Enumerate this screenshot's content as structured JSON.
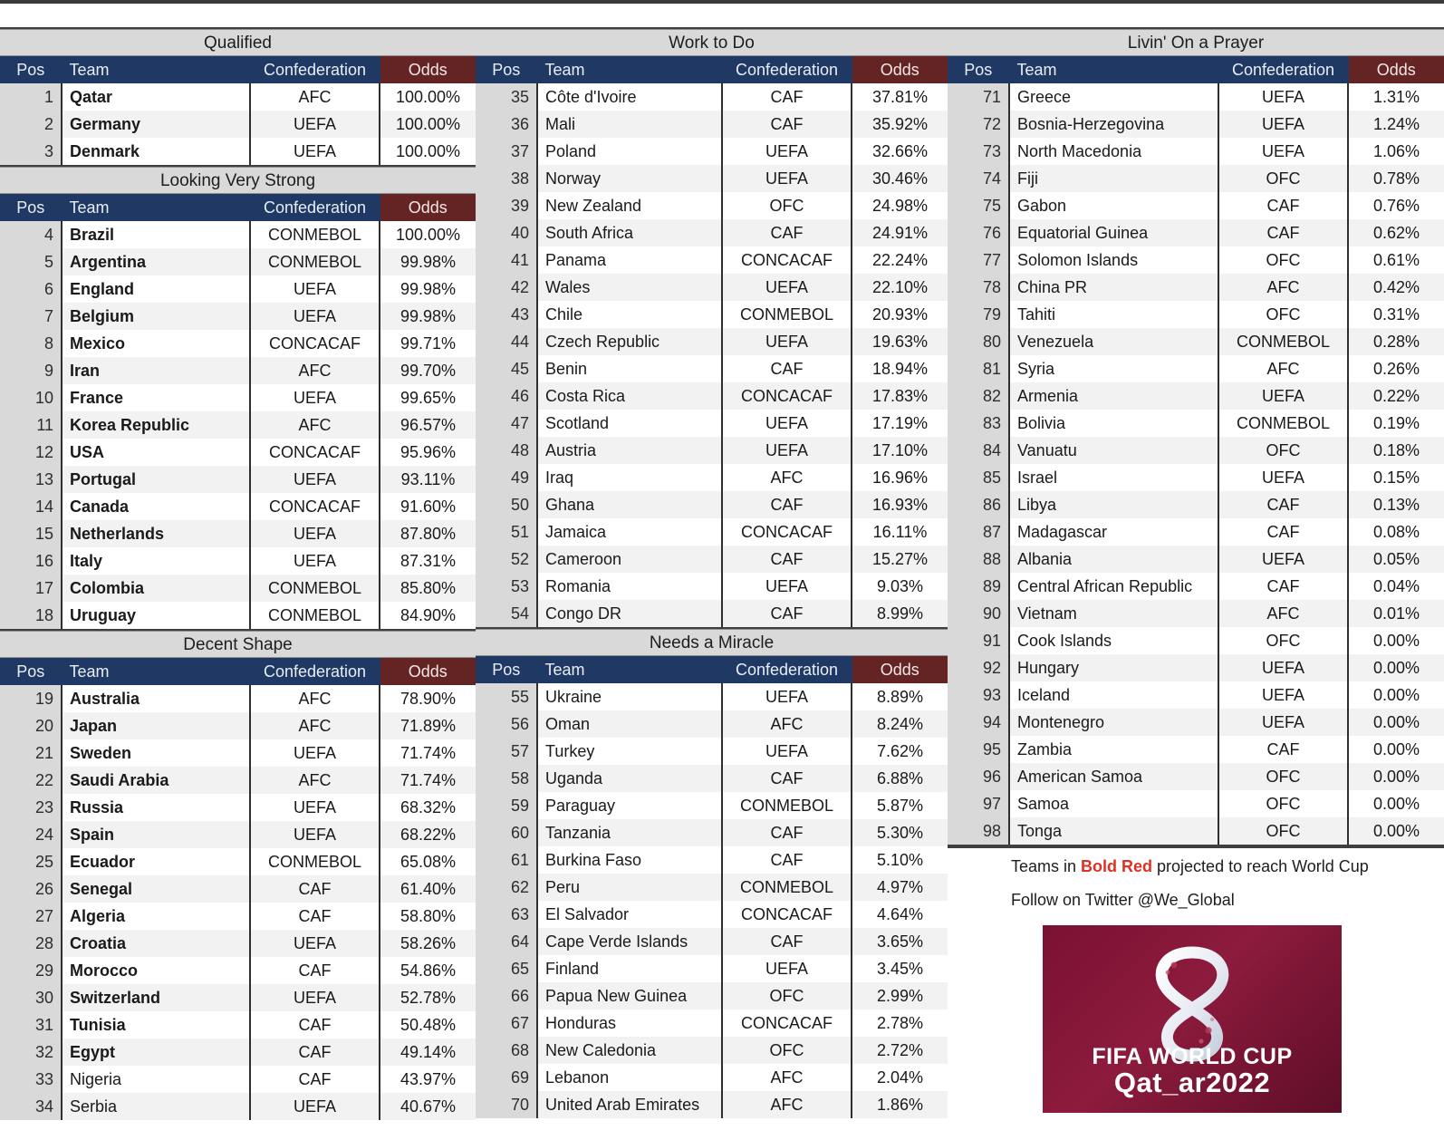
{
  "columns_headers": {
    "pos": "Pos",
    "team": "Team",
    "confederation": "Confederation",
    "odds": "Odds"
  },
  "colors": {
    "header_navy": "#203864",
    "header_maroon": "#632423",
    "band_gray": "#d9d9d9",
    "qualified_red": "#e03024"
  },
  "sections": [
    {
      "id": "qualified",
      "title": "Qualified",
      "rows": [
        {
          "pos": "1",
          "team": "Qatar",
          "conf": "AFC",
          "odds": "100.00%",
          "q": true
        },
        {
          "pos": "2",
          "team": "Germany",
          "conf": "UEFA",
          "odds": "100.00%",
          "q": true
        },
        {
          "pos": "3",
          "team": "Denmark",
          "conf": "UEFA",
          "odds": "100.00%",
          "q": true
        }
      ]
    },
    {
      "id": "looking-very-strong",
      "title": "Looking Very Strong",
      "rows": [
        {
          "pos": "4",
          "team": "Brazil",
          "conf": "CONMEBOL",
          "odds": "100.00%",
          "q": true
        },
        {
          "pos": "5",
          "team": "Argentina",
          "conf": "CONMEBOL",
          "odds": "99.98%",
          "q": true
        },
        {
          "pos": "6",
          "team": "England",
          "conf": "UEFA",
          "odds": "99.98%",
          "q": true
        },
        {
          "pos": "7",
          "team": "Belgium",
          "conf": "UEFA",
          "odds": "99.98%",
          "q": true
        },
        {
          "pos": "8",
          "team": "Mexico",
          "conf": "CONCACAF",
          "odds": "99.71%",
          "q": true
        },
        {
          "pos": "9",
          "team": "Iran",
          "conf": "AFC",
          "odds": "99.70%",
          "q": true
        },
        {
          "pos": "10",
          "team": "France",
          "conf": "UEFA",
          "odds": "99.65%",
          "q": true
        },
        {
          "pos": "11",
          "team": "Korea Republic",
          "conf": "AFC",
          "odds": "96.57%",
          "q": true
        },
        {
          "pos": "12",
          "team": "USA",
          "conf": "CONCACAF",
          "odds": "95.96%",
          "q": true
        },
        {
          "pos": "13",
          "team": "Portugal",
          "conf": "UEFA",
          "odds": "93.11%",
          "q": true
        },
        {
          "pos": "14",
          "team": "Canada",
          "conf": "CONCACAF",
          "odds": "91.60%",
          "q": true
        },
        {
          "pos": "15",
          "team": "Netherlands",
          "conf": "UEFA",
          "odds": "87.80%",
          "q": true
        },
        {
          "pos": "16",
          "team": "Italy",
          "conf": "UEFA",
          "odds": "87.31%",
          "q": true
        },
        {
          "pos": "17",
          "team": "Colombia",
          "conf": "CONMEBOL",
          "odds": "85.80%",
          "q": true
        },
        {
          "pos": "18",
          "team": "Uruguay",
          "conf": "CONMEBOL",
          "odds": "84.90%",
          "q": true
        }
      ]
    },
    {
      "id": "decent-shape",
      "title": "Decent Shape",
      "rows": [
        {
          "pos": "19",
          "team": "Australia",
          "conf": "AFC",
          "odds": "78.90%",
          "q": true
        },
        {
          "pos": "20",
          "team": "Japan",
          "conf": "AFC",
          "odds": "71.89%",
          "q": true
        },
        {
          "pos": "21",
          "team": "Sweden",
          "conf": "UEFA",
          "odds": "71.74%",
          "q": true
        },
        {
          "pos": "22",
          "team": "Saudi Arabia",
          "conf": "AFC",
          "odds": "71.74%",
          "q": true
        },
        {
          "pos": "23",
          "team": "Russia",
          "conf": "UEFA",
          "odds": "68.32%",
          "q": true
        },
        {
          "pos": "24",
          "team": "Spain",
          "conf": "UEFA",
          "odds": "68.22%",
          "q": true
        },
        {
          "pos": "25",
          "team": "Ecuador",
          "conf": "CONMEBOL",
          "odds": "65.08%",
          "q": true
        },
        {
          "pos": "26",
          "team": "Senegal",
          "conf": "CAF",
          "odds": "61.40%",
          "q": true
        },
        {
          "pos": "27",
          "team": "Algeria",
          "conf": "CAF",
          "odds": "58.80%",
          "q": true
        },
        {
          "pos": "28",
          "team": "Croatia",
          "conf": "UEFA",
          "odds": "58.26%",
          "q": true
        },
        {
          "pos": "29",
          "team": "Morocco",
          "conf": "CAF",
          "odds": "54.86%",
          "q": true
        },
        {
          "pos": "30",
          "team": "Switzerland",
          "conf": "UEFA",
          "odds": "52.78%",
          "q": true
        },
        {
          "pos": "31",
          "team": "Tunisia",
          "conf": "CAF",
          "odds": "50.48%",
          "q": true
        },
        {
          "pos": "32",
          "team": "Egypt",
          "conf": "CAF",
          "odds": "49.14%",
          "q": true
        },
        {
          "pos": "33",
          "team": "Nigeria",
          "conf": "CAF",
          "odds": "43.97%",
          "q": false
        },
        {
          "pos": "34",
          "team": "Serbia",
          "conf": "UEFA",
          "odds": "40.67%",
          "q": false
        }
      ]
    },
    {
      "id": "work-to-do",
      "title": "Work to Do",
      "rows": [
        {
          "pos": "35",
          "team": "Côte d'Ivoire",
          "conf": "CAF",
          "odds": "37.81%",
          "q": false
        },
        {
          "pos": "36",
          "team": "Mali",
          "conf": "CAF",
          "odds": "35.92%",
          "q": false
        },
        {
          "pos": "37",
          "team": "Poland",
          "conf": "UEFA",
          "odds": "32.66%",
          "q": false
        },
        {
          "pos": "38",
          "team": "Norway",
          "conf": "UEFA",
          "odds": "30.46%",
          "q": false
        },
        {
          "pos": "39",
          "team": "New Zealand",
          "conf": "OFC",
          "odds": "24.98%",
          "q": false
        },
        {
          "pos": "40",
          "team": "South Africa",
          "conf": "CAF",
          "odds": "24.91%",
          "q": false
        },
        {
          "pos": "41",
          "team": "Panama",
          "conf": "CONCACAF",
          "odds": "22.24%",
          "q": false
        },
        {
          "pos": "42",
          "team": "Wales",
          "conf": "UEFA",
          "odds": "22.10%",
          "q": false
        },
        {
          "pos": "43",
          "team": "Chile",
          "conf": "CONMEBOL",
          "odds": "20.93%",
          "q": false
        },
        {
          "pos": "44",
          "team": "Czech Republic",
          "conf": "UEFA",
          "odds": "19.63%",
          "q": false
        },
        {
          "pos": "45",
          "team": "Benin",
          "conf": "CAF",
          "odds": "18.94%",
          "q": false
        },
        {
          "pos": "46",
          "team": "Costa Rica",
          "conf": "CONCACAF",
          "odds": "17.83%",
          "q": false
        },
        {
          "pos": "47",
          "team": "Scotland",
          "conf": "UEFA",
          "odds": "17.19%",
          "q": false
        },
        {
          "pos": "48",
          "team": "Austria",
          "conf": "UEFA",
          "odds": "17.10%",
          "q": false
        },
        {
          "pos": "49",
          "team": "Iraq",
          "conf": "AFC",
          "odds": "16.96%",
          "q": false
        },
        {
          "pos": "50",
          "team": "Ghana",
          "conf": "CAF",
          "odds": "16.93%",
          "q": false
        },
        {
          "pos": "51",
          "team": "Jamaica",
          "conf": "CONCACAF",
          "odds": "16.11%",
          "q": false
        },
        {
          "pos": "52",
          "team": "Cameroon",
          "conf": "CAF",
          "odds": "15.27%",
          "q": false
        },
        {
          "pos": "53",
          "team": "Romania",
          "conf": "UEFA",
          "odds": "9.03%",
          "q": false
        },
        {
          "pos": "54",
          "team": "Congo DR",
          "conf": "CAF",
          "odds": "8.99%",
          "q": false
        }
      ]
    },
    {
      "id": "needs-a-miracle",
      "title": "Needs a Miracle",
      "rows": [
        {
          "pos": "55",
          "team": "Ukraine",
          "conf": "UEFA",
          "odds": "8.89%",
          "q": false
        },
        {
          "pos": "56",
          "team": "Oman",
          "conf": "AFC",
          "odds": "8.24%",
          "q": false
        },
        {
          "pos": "57",
          "team": "Turkey",
          "conf": "UEFA",
          "odds": "7.62%",
          "q": false
        },
        {
          "pos": "58",
          "team": "Uganda",
          "conf": "CAF",
          "odds": "6.88%",
          "q": false
        },
        {
          "pos": "59",
          "team": "Paraguay",
          "conf": "CONMEBOL",
          "odds": "5.87%",
          "q": false
        },
        {
          "pos": "60",
          "team": "Tanzania",
          "conf": "CAF",
          "odds": "5.30%",
          "q": false
        },
        {
          "pos": "61",
          "team": "Burkina Faso",
          "conf": "CAF",
          "odds": "5.10%",
          "q": false
        },
        {
          "pos": "62",
          "team": "Peru",
          "conf": "CONMEBOL",
          "odds": "4.97%",
          "q": false
        },
        {
          "pos": "63",
          "team": "El Salvador",
          "conf": "CONCACAF",
          "odds": "4.64%",
          "q": false
        },
        {
          "pos": "64",
          "team": "Cape Verde Islands",
          "conf": "CAF",
          "odds": "3.65%",
          "q": false
        },
        {
          "pos": "65",
          "team": "Finland",
          "conf": "UEFA",
          "odds": "3.45%",
          "q": false
        },
        {
          "pos": "66",
          "team": "Papua New Guinea",
          "conf": "OFC",
          "odds": "2.99%",
          "q": false
        },
        {
          "pos": "67",
          "team": "Honduras",
          "conf": "CONCACAF",
          "odds": "2.78%",
          "q": false
        },
        {
          "pos": "68",
          "team": "New Caledonia",
          "conf": "OFC",
          "odds": "2.72%",
          "q": false
        },
        {
          "pos": "69",
          "team": "Lebanon",
          "conf": "AFC",
          "odds": "2.04%",
          "q": false
        },
        {
          "pos": "70",
          "team": "United Arab Emirates",
          "conf": "AFC",
          "odds": "1.86%",
          "q": false
        }
      ]
    },
    {
      "id": "livin-on-a-prayer",
      "title": "Livin' On a Prayer",
      "rows": [
        {
          "pos": "71",
          "team": "Greece",
          "conf": "UEFA",
          "odds": "1.31%",
          "q": false
        },
        {
          "pos": "72",
          "team": "Bosnia-Herzegovina",
          "conf": "UEFA",
          "odds": "1.24%",
          "q": false
        },
        {
          "pos": "73",
          "team": "North Macedonia",
          "conf": "UEFA",
          "odds": "1.06%",
          "q": false
        },
        {
          "pos": "74",
          "team": "Fiji",
          "conf": "OFC",
          "odds": "0.78%",
          "q": false
        },
        {
          "pos": "75",
          "team": "Gabon",
          "conf": "CAF",
          "odds": "0.76%",
          "q": false
        },
        {
          "pos": "76",
          "team": "Equatorial Guinea",
          "conf": "CAF",
          "odds": "0.62%",
          "q": false
        },
        {
          "pos": "77",
          "team": "Solomon Islands",
          "conf": "OFC",
          "odds": "0.61%",
          "q": false
        },
        {
          "pos": "78",
          "team": "China PR",
          "conf": "AFC",
          "odds": "0.42%",
          "q": false
        },
        {
          "pos": "79",
          "team": "Tahiti",
          "conf": "OFC",
          "odds": "0.31%",
          "q": false
        },
        {
          "pos": "80",
          "team": "Venezuela",
          "conf": "CONMEBOL",
          "odds": "0.28%",
          "q": false
        },
        {
          "pos": "81",
          "team": "Syria",
          "conf": "AFC",
          "odds": "0.26%",
          "q": false
        },
        {
          "pos": "82",
          "team": "Armenia",
          "conf": "UEFA",
          "odds": "0.22%",
          "q": false
        },
        {
          "pos": "83",
          "team": "Bolivia",
          "conf": "CONMEBOL",
          "odds": "0.19%",
          "q": false
        },
        {
          "pos": "84",
          "team": "Vanuatu",
          "conf": "OFC",
          "odds": "0.18%",
          "q": false
        },
        {
          "pos": "85",
          "team": "Israel",
          "conf": "UEFA",
          "odds": "0.15%",
          "q": false
        },
        {
          "pos": "86",
          "team": "Libya",
          "conf": "CAF",
          "odds": "0.13%",
          "q": false
        },
        {
          "pos": "87",
          "team": "Madagascar",
          "conf": "CAF",
          "odds": "0.08%",
          "q": false
        },
        {
          "pos": "88",
          "team": "Albania",
          "conf": "UEFA",
          "odds": "0.05%",
          "q": false
        },
        {
          "pos": "89",
          "team": "Central African Republic",
          "conf": "CAF",
          "odds": "0.04%",
          "q": false
        },
        {
          "pos": "90",
          "team": "Vietnam",
          "conf": "AFC",
          "odds": "0.01%",
          "q": false
        },
        {
          "pos": "91",
          "team": "Cook Islands",
          "conf": "OFC",
          "odds": "0.00%",
          "q": false
        },
        {
          "pos": "92",
          "team": "Hungary",
          "conf": "UEFA",
          "odds": "0.00%",
          "q": false
        },
        {
          "pos": "93",
          "team": "Iceland",
          "conf": "UEFA",
          "odds": "0.00%",
          "q": false
        },
        {
          "pos": "94",
          "team": "Montenegro",
          "conf": "UEFA",
          "odds": "0.00%",
          "q": false
        },
        {
          "pos": "95",
          "team": "Zambia",
          "conf": "CAF",
          "odds": "0.00%",
          "q": false
        },
        {
          "pos": "96",
          "team": "American Samoa",
          "conf": "OFC",
          "odds": "0.00%",
          "q": false
        },
        {
          "pos": "97",
          "team": "Samoa",
          "conf": "OFC",
          "odds": "0.00%",
          "q": false
        },
        {
          "pos": "98",
          "team": "Tonga",
          "conf": "OFC",
          "odds": "0.00%",
          "q": false
        }
      ]
    }
  ],
  "footer": {
    "legend_prefix": "Teams in ",
    "legend_highlight": "Bold Red",
    "legend_suffix": " projected to reach World Cup",
    "twitter": "Follow on Twitter @We_Global",
    "logo": {
      "line1": "FIFA WORLD CUP",
      "line2": "Qat_ar2022",
      "alt": "fifa-world-cup-qatar-2022-logo"
    }
  }
}
